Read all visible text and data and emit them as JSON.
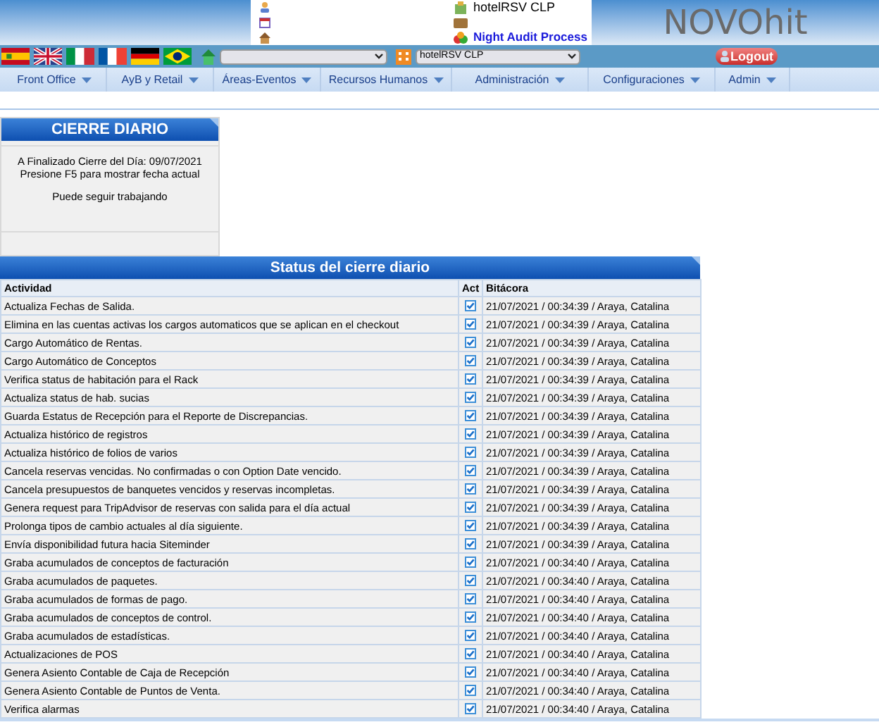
{
  "header": {
    "hotel": "hotelRSV CLP",
    "process": "Night Audit Process",
    "logo": "NOVOhit"
  },
  "toolbar": {
    "hotel_select": "hotelRSV CLP",
    "logout": "Logout"
  },
  "menu": [
    "Front Office",
    "AyB y Retail",
    "Áreas-Eventos",
    "Recursos Humanos",
    "Administración",
    "Configuraciones",
    "Admin"
  ],
  "cierre": {
    "title": "CIERRE DIARIO",
    "lines": [
      "A Finalizado Cierre del Día: 09/07/2021",
      "Presione F5 para mostrar fecha actual"
    ],
    "note": "Puede seguir trabajando"
  },
  "status": {
    "title": "Status del cierre diario",
    "columns": [
      "Actividad",
      "Act",
      "Bitácora"
    ],
    "rows": [
      {
        "actividad": "Actualiza Fechas de Salida.",
        "checked": true,
        "bitacora": "21/07/2021 / 00:34:39 / Araya, Catalina"
      },
      {
        "actividad": "Elimina en las cuentas activas los cargos automaticos que se aplican en el checkout",
        "checked": true,
        "bitacora": "21/07/2021 / 00:34:39 / Araya, Catalina"
      },
      {
        "actividad": "Cargo Automático de Rentas.",
        "checked": true,
        "bitacora": "21/07/2021 / 00:34:39 / Araya, Catalina"
      },
      {
        "actividad": "Cargo Automático de Conceptos",
        "checked": true,
        "bitacora": "21/07/2021 / 00:34:39 / Araya, Catalina"
      },
      {
        "actividad": "Verifica status de habitación para el Rack",
        "checked": true,
        "bitacora": "21/07/2021 / 00:34:39 / Araya, Catalina"
      },
      {
        "actividad": "Actualiza status de hab. sucias",
        "checked": true,
        "bitacora": "21/07/2021 / 00:34:39 / Araya, Catalina"
      },
      {
        "actividad": "Guarda Estatus de Recepción para el Reporte de Discrepancias.",
        "checked": true,
        "bitacora": "21/07/2021 / 00:34:39 / Araya, Catalina"
      },
      {
        "actividad": "Actualiza histórico de registros",
        "checked": true,
        "bitacora": "21/07/2021 / 00:34:39 / Araya, Catalina"
      },
      {
        "actividad": "Actualiza histórico de folios de varios",
        "checked": true,
        "bitacora": "21/07/2021 / 00:34:39 / Araya, Catalina"
      },
      {
        "actividad": "Cancela reservas vencidas. No confirmadas o con Option Date vencido.",
        "checked": true,
        "bitacora": "21/07/2021 / 00:34:39 / Araya, Catalina"
      },
      {
        "actividad": "Cancela presupuestos de banquetes vencidos y reservas incompletas.",
        "checked": true,
        "bitacora": "21/07/2021 / 00:34:39 / Araya, Catalina"
      },
      {
        "actividad": "Genera request para TripAdvisor de reservas con salida para el día actual",
        "checked": true,
        "bitacora": "21/07/2021 / 00:34:39 / Araya, Catalina"
      },
      {
        "actividad": "Prolonga tipos de cambio actuales al día siguiente.",
        "checked": true,
        "bitacora": "21/07/2021 / 00:34:39 / Araya, Catalina"
      },
      {
        "actividad": "Envía disponibilidad futura hacia Siteminder",
        "checked": true,
        "bitacora": "21/07/2021 / 00:34:39 / Araya, Catalina"
      },
      {
        "actividad": "Graba acumulados de conceptos de facturación",
        "checked": true,
        "bitacora": "21/07/2021 / 00:34:40 / Araya, Catalina"
      },
      {
        "actividad": "Graba acumulados de paquetes.",
        "checked": true,
        "bitacora": "21/07/2021 / 00:34:40 / Araya, Catalina"
      },
      {
        "actividad": "Graba acumulados de formas de pago.",
        "checked": true,
        "bitacora": "21/07/2021 / 00:34:40 / Araya, Catalina"
      },
      {
        "actividad": "Graba acumulados de conceptos de control.",
        "checked": true,
        "bitacora": "21/07/2021 / 00:34:40 / Araya, Catalina"
      },
      {
        "actividad": "Graba acumulados de estadísticas.",
        "checked": true,
        "bitacora": "21/07/2021 / 00:34:40 / Araya, Catalina"
      },
      {
        "actividad": "Actualizaciones de POS",
        "checked": true,
        "bitacora": "21/07/2021 / 00:34:40 / Araya, Catalina"
      },
      {
        "actividad": "Genera Asiento Contable de Caja de Recepción",
        "checked": true,
        "bitacora": "21/07/2021 / 00:34:40 / Araya, Catalina"
      },
      {
        "actividad": "Genera Asiento Contable de Puntos de Venta.",
        "checked": true,
        "bitacora": "21/07/2021 / 00:34:40 / Araya, Catalina"
      },
      {
        "actividad": "Verifica alarmas",
        "checked": true,
        "bitacora": "21/07/2021 / 00:34:40 / Araya, Catalina"
      }
    ]
  }
}
